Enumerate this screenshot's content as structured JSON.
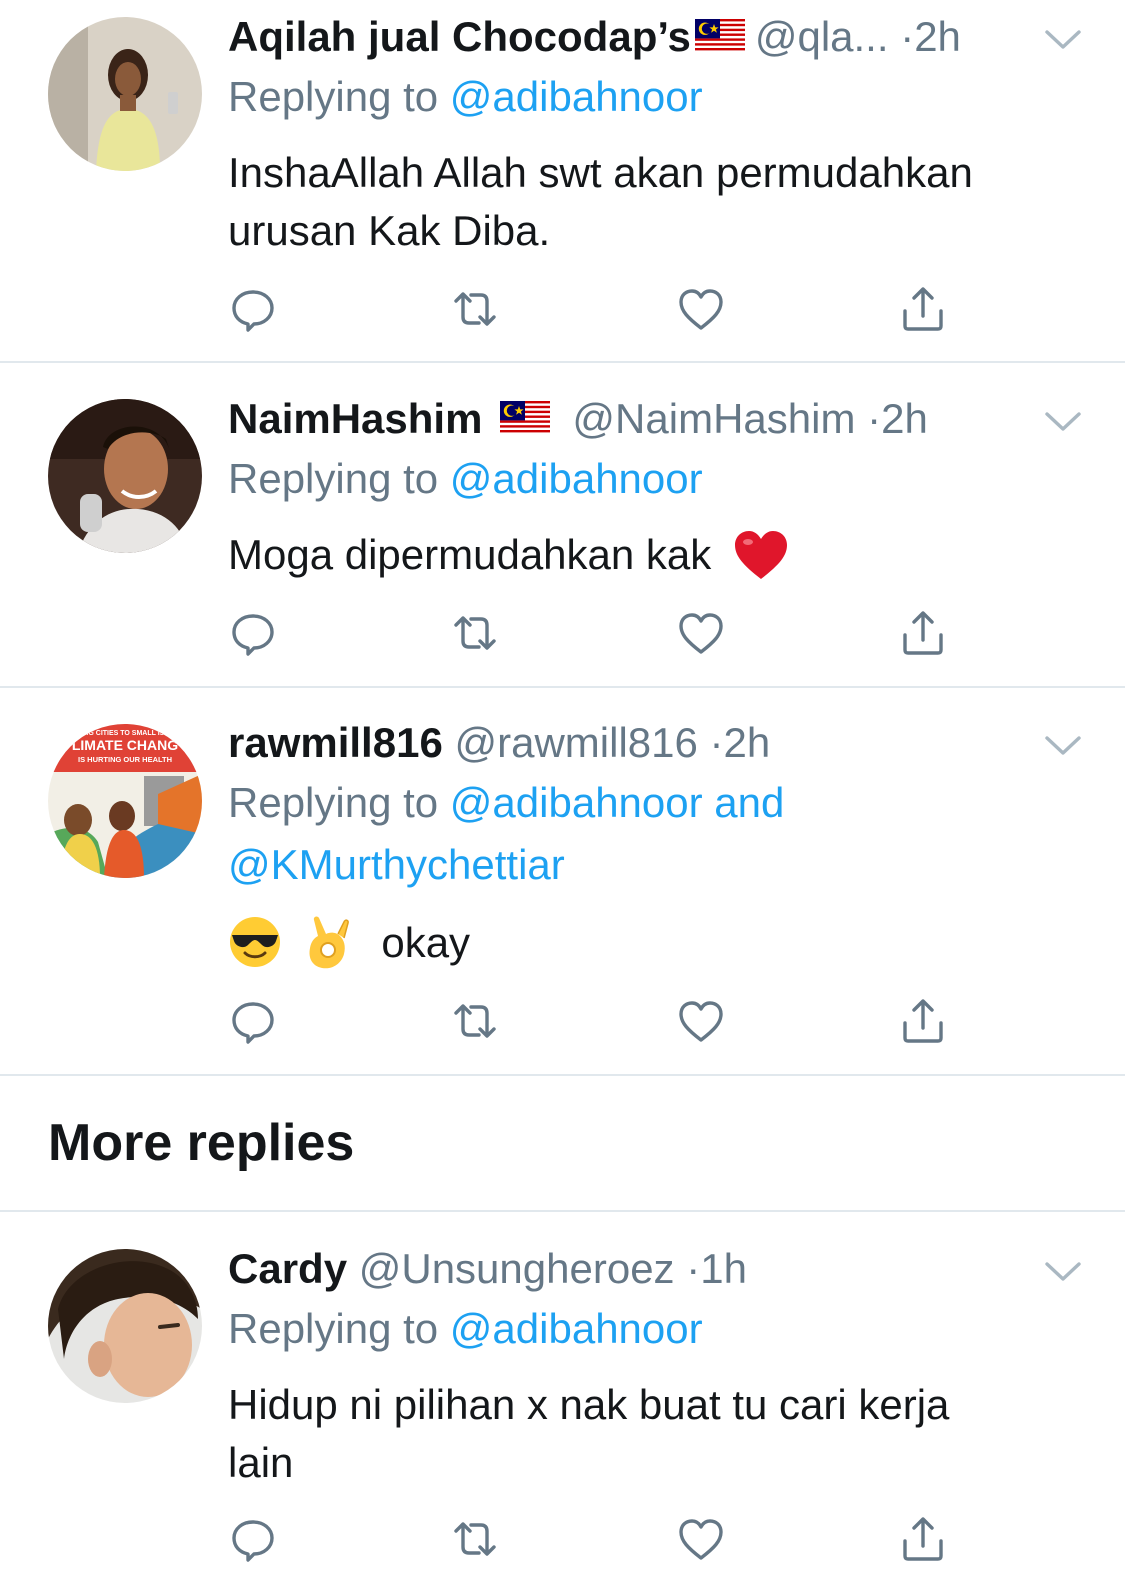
{
  "colors": {
    "accent": "#1da1f2",
    "secondary_text": "#657786",
    "divider": "#e1e8ed",
    "heart_red": "#e0162b"
  },
  "tweets": [
    {
      "name": "Aqilah jual Chocodap’s",
      "handle": "@qla...",
      "dot": "·",
      "time": "2h",
      "flag": "malaysia-flag-icon",
      "replying_prefix": "Replying to",
      "mentions": [
        "@adibahnoor"
      ],
      "text_lines": [
        "InshaAllah Allah swt akan permudahkan",
        "urusan Kak Diba."
      ]
    },
    {
      "name": "NaimHashim",
      "handle": "@NaimHashim",
      "dot": "·",
      "time": "2h",
      "flag": "malaysia-flag-icon",
      "replying_prefix": "Replying to",
      "mentions": [
        "@adibahnoor"
      ],
      "text": "Moga dipermudahkan kak",
      "emoji": "red-heart-emoji"
    },
    {
      "name": "rawmill816",
      "handle": "@rawmill816",
      "dot": "·",
      "time": "2h",
      "replying_prefix": "Replying to",
      "mentions": [
        "@adibahnoor and",
        "@KMurthychettiar"
      ],
      "emojis": [
        "sunglasses-face-emoji",
        "ok-hand-emoji"
      ],
      "text": "okay",
      "avatar_text": [
        "BIG CITIES TO SMALL ISL",
        "LIMATE CHANG",
        "IS HURTING OUR HEALTH"
      ]
    },
    {
      "name": "Cardy",
      "handle": "@Unsungheroez",
      "dot": "·",
      "time": "1h",
      "replying_prefix": "Replying to",
      "mentions": [
        "@adibahnoor"
      ],
      "text_lines": [
        "Hidup ni pilihan x nak buat tu cari kerja",
        "lain"
      ]
    }
  ],
  "section": {
    "more_replies": "More replies"
  },
  "actions": [
    "reply-icon",
    "retweet-icon",
    "like-icon",
    "share-icon"
  ]
}
